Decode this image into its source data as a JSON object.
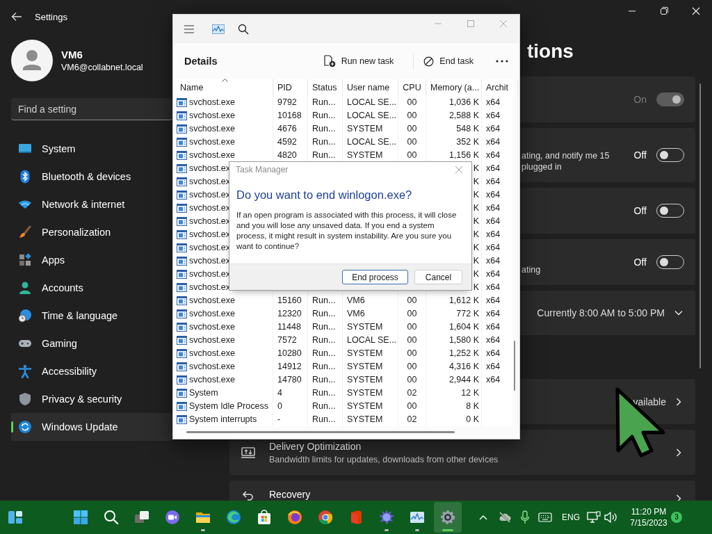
{
  "settings": {
    "title": "Settings",
    "user": {
      "name": "VM6",
      "email": "VM6@collabnet.local"
    },
    "search": {
      "placeholder": "Find a setting"
    },
    "nav": [
      {
        "label": "System",
        "selected": false
      },
      {
        "label": "Bluetooth & devices",
        "selected": false
      },
      {
        "label": "Network & internet",
        "selected": false
      },
      {
        "label": "Personalization",
        "selected": false
      },
      {
        "label": "Apps",
        "selected": false
      },
      {
        "label": "Accounts",
        "selected": false
      },
      {
        "label": "Time & language",
        "selected": false
      },
      {
        "label": "Gaming",
        "selected": false
      },
      {
        "label": "Accessibility",
        "selected": false
      },
      {
        "label": "Privacy & security",
        "selected": false
      },
      {
        "label": "Windows Update",
        "selected": true
      }
    ],
    "heading": "tions",
    "cards": [
      {
        "kind": "toggle",
        "status": "On",
        "on": true,
        "disabled": true
      },
      {
        "kind": "toggle",
        "description": [
          "ating, and notify me 15",
          "plugged in"
        ],
        "status": "Off",
        "on": false,
        "disabled": false
      },
      {
        "kind": "toggle",
        "status": "Off",
        "on": false,
        "disabled": false
      },
      {
        "kind": "toggle",
        "description": [
          "ating"
        ],
        "status": "Off",
        "on": false,
        "disabled": false
      },
      {
        "kind": "select",
        "value": "Currently 8:00 AM to 5:00 PM"
      },
      {
        "kind": "link",
        "value": "vailable"
      },
      {
        "kind": "item",
        "title": "Delivery Optimization",
        "subtitle": "Bandwidth limits for updates, downloads from other devices"
      },
      {
        "kind": "item",
        "title": "Recovery"
      }
    ]
  },
  "task_manager": {
    "page_title": "Details",
    "actions": [
      {
        "label": "Run new task"
      },
      {
        "label": "End task"
      }
    ],
    "columns": [
      {
        "label": "Name",
        "sorted": true
      },
      {
        "label": "PID",
        "sorted": false
      },
      {
        "label": "Status",
        "sorted": false
      },
      {
        "label": "User name",
        "sorted": false
      },
      {
        "label": "CPU",
        "sorted": false
      },
      {
        "label": "Memory (a...",
        "sorted": false
      },
      {
        "label": "Archit",
        "sorted": false
      }
    ],
    "rows": [
      {
        "name": "svchost.exe",
        "pid": "9792",
        "status": "Run...",
        "user": "LOCAL SE...",
        "cpu": "00",
        "memory": "1,036 K",
        "arch": "x64"
      },
      {
        "name": "svchost.exe",
        "pid": "10168",
        "status": "Run...",
        "user": "LOCAL SE...",
        "cpu": "00",
        "memory": "2,588 K",
        "arch": "x64"
      },
      {
        "name": "svchost.exe",
        "pid": "4676",
        "status": "Run...",
        "user": "SYSTEM",
        "cpu": "00",
        "memory": "548 K",
        "arch": "x64"
      },
      {
        "name": "svchost.exe",
        "pid": "4592",
        "status": "Run...",
        "user": "LOCAL SE...",
        "cpu": "00",
        "memory": "352 K",
        "arch": "x64"
      },
      {
        "name": "svchost.exe",
        "pid": "4820",
        "status": "Run...",
        "user": "SYSTEM",
        "cpu": "00",
        "memory": "1,156 K",
        "arch": "x64"
      },
      {
        "name": "svchost.ex",
        "memory": "K",
        "arch": "x64"
      },
      {
        "name": "svchost.ex",
        "memory": "K",
        "arch": "x64"
      },
      {
        "name": "svchost.ex",
        "memory": "K",
        "arch": "x64"
      },
      {
        "name": "svchost.ex",
        "memory": "K",
        "arch": "x64"
      },
      {
        "name": "svchost.ex",
        "memory": "K",
        "arch": "x64"
      },
      {
        "name": "svchost.ex",
        "memory": "K",
        "arch": "x64"
      },
      {
        "name": "svchost.ex",
        "memory": "K",
        "arch": "x64"
      },
      {
        "name": "svchost.ex",
        "memory": "K",
        "arch": "x64"
      },
      {
        "name": "svchost.ex",
        "memory": "K",
        "arch": "x64"
      },
      {
        "name": "svchost.ex",
        "memory": "K",
        "arch": "x64"
      },
      {
        "name": "svchost.exe",
        "pid": "15160",
        "status": "Run...",
        "user": "VM6",
        "cpu": "00",
        "memory": "1,612 K",
        "arch": "x64"
      },
      {
        "name": "svchost.exe",
        "pid": "12320",
        "status": "Run...",
        "user": "VM6",
        "cpu": "00",
        "memory": "772 K",
        "arch": "x64"
      },
      {
        "name": "svchost.exe",
        "pid": "11448",
        "status": "Run...",
        "user": "SYSTEM",
        "cpu": "00",
        "memory": "1,604 K",
        "arch": "x64"
      },
      {
        "name": "svchost.exe",
        "pid": "7572",
        "status": "Run...",
        "user": "LOCAL SE...",
        "cpu": "00",
        "memory": "1,580 K",
        "arch": "x64"
      },
      {
        "name": "svchost.exe",
        "pid": "10280",
        "status": "Run...",
        "user": "SYSTEM",
        "cpu": "00",
        "memory": "1,252 K",
        "arch": "x64"
      },
      {
        "name": "svchost.exe",
        "pid": "14912",
        "status": "Run...",
        "user": "SYSTEM",
        "cpu": "00",
        "memory": "4,316 K",
        "arch": "x64"
      },
      {
        "name": "svchost.exe",
        "pid": "14780",
        "status": "Run...",
        "user": "SYSTEM",
        "cpu": "00",
        "memory": "2,944 K",
        "arch": "x64"
      },
      {
        "name": "System",
        "pid": "4",
        "status": "Run...",
        "user": "SYSTEM",
        "cpu": "02",
        "memory": "12 K"
      },
      {
        "name": "System Idle Process",
        "pid": "0",
        "status": "Run...",
        "user": "SYSTEM",
        "cpu": "00",
        "memory": "8 K"
      },
      {
        "name": "System interrupts",
        "pid": "-",
        "status": "Run...",
        "user": "SYSTEM",
        "cpu": "02",
        "memory": "0 K"
      }
    ]
  },
  "dialog": {
    "title": "Task Manager",
    "heading": "Do you want to end winlogon.exe?",
    "message": "If an open program is associated with this process, it will close and you will lose any unsaved data. If you end a system process, it might result in system instability. Are you sure you want to continue?",
    "buttons": [
      {
        "label": "End process",
        "default": true
      },
      {
        "label": "Cancel",
        "default": false
      }
    ]
  },
  "taskbar": {
    "apps": [
      {
        "running": false,
        "selected": false
      },
      {
        "running": false,
        "selected": false
      },
      {
        "running": false,
        "selected": false
      },
      {
        "running": false,
        "selected": false
      },
      {
        "running": true,
        "selected": false
      },
      {
        "running": false,
        "selected": false
      },
      {
        "running": false,
        "selected": false
      },
      {
        "running": false,
        "selected": false
      },
      {
        "running": false,
        "selected": false
      },
      {
        "running": false,
        "selected": false
      },
      {
        "running": true,
        "selected": false
      },
      {
        "running": true,
        "selected": false
      },
      {
        "running": true,
        "selected": true
      }
    ],
    "language": "ENG",
    "time": "11:20 PM",
    "date": "7/15/2023",
    "notifications": "3"
  }
}
